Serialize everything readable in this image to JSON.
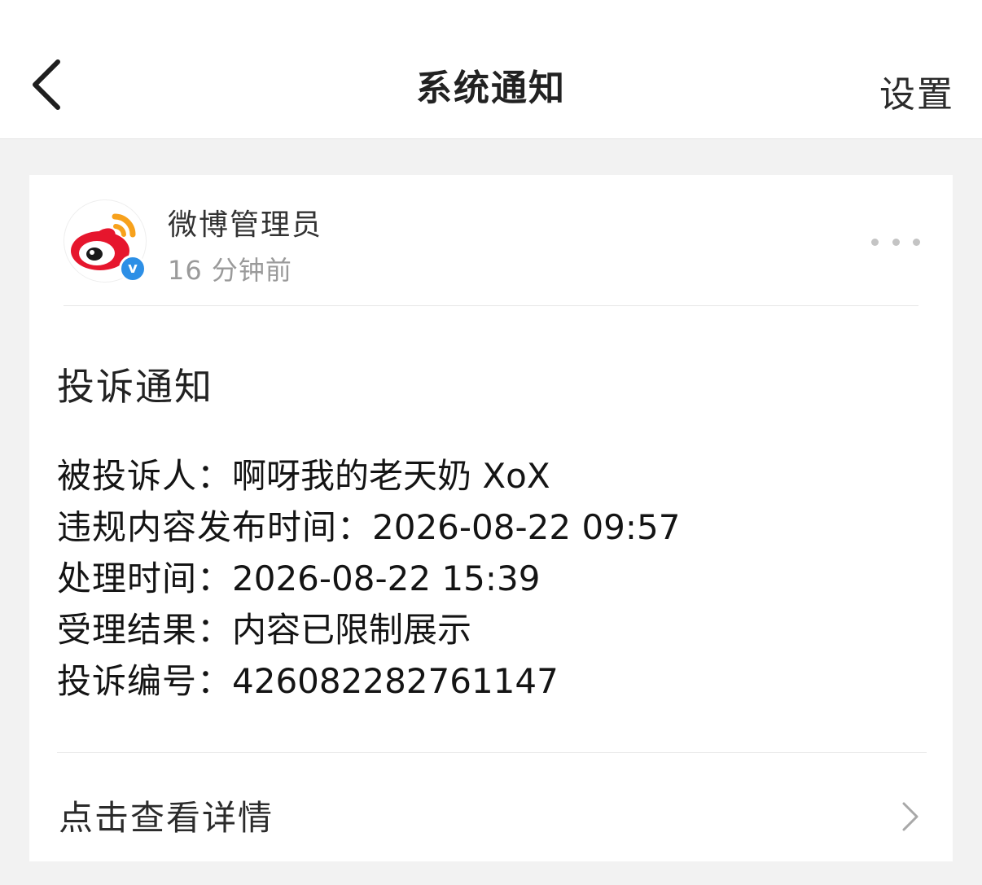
{
  "header": {
    "title": "系统通知",
    "settings_label": "设置"
  },
  "notification": {
    "sender": {
      "name": "微博管理员",
      "time": "16 分钟前",
      "verified_mark": "v"
    },
    "title": "投诉通知",
    "fields": [
      {
        "label": "被投诉人：",
        "value": "啊呀我的老天奶 XoX"
      },
      {
        "label": "违规内容发布时间：",
        "value": "2026-08-22 09:57"
      },
      {
        "label": "处理时间：",
        "value": "2026-08-22 15:39"
      },
      {
        "label": "受理结果：",
        "value": "内容已限制展示"
      },
      {
        "label": "投诉编号：",
        "value": "426082282761147"
      }
    ],
    "detail_link_label": "点击查看详情"
  },
  "colors": {
    "weibo_red": "#e6162d",
    "weibo_orange": "#f7a11c",
    "verified_blue": "#2d8fe6"
  },
  "icons": {
    "back": "chevron-left-icon",
    "more": "more-dots-icon",
    "detail": "chevron-right-icon",
    "avatar": "weibo-logo-icon"
  }
}
